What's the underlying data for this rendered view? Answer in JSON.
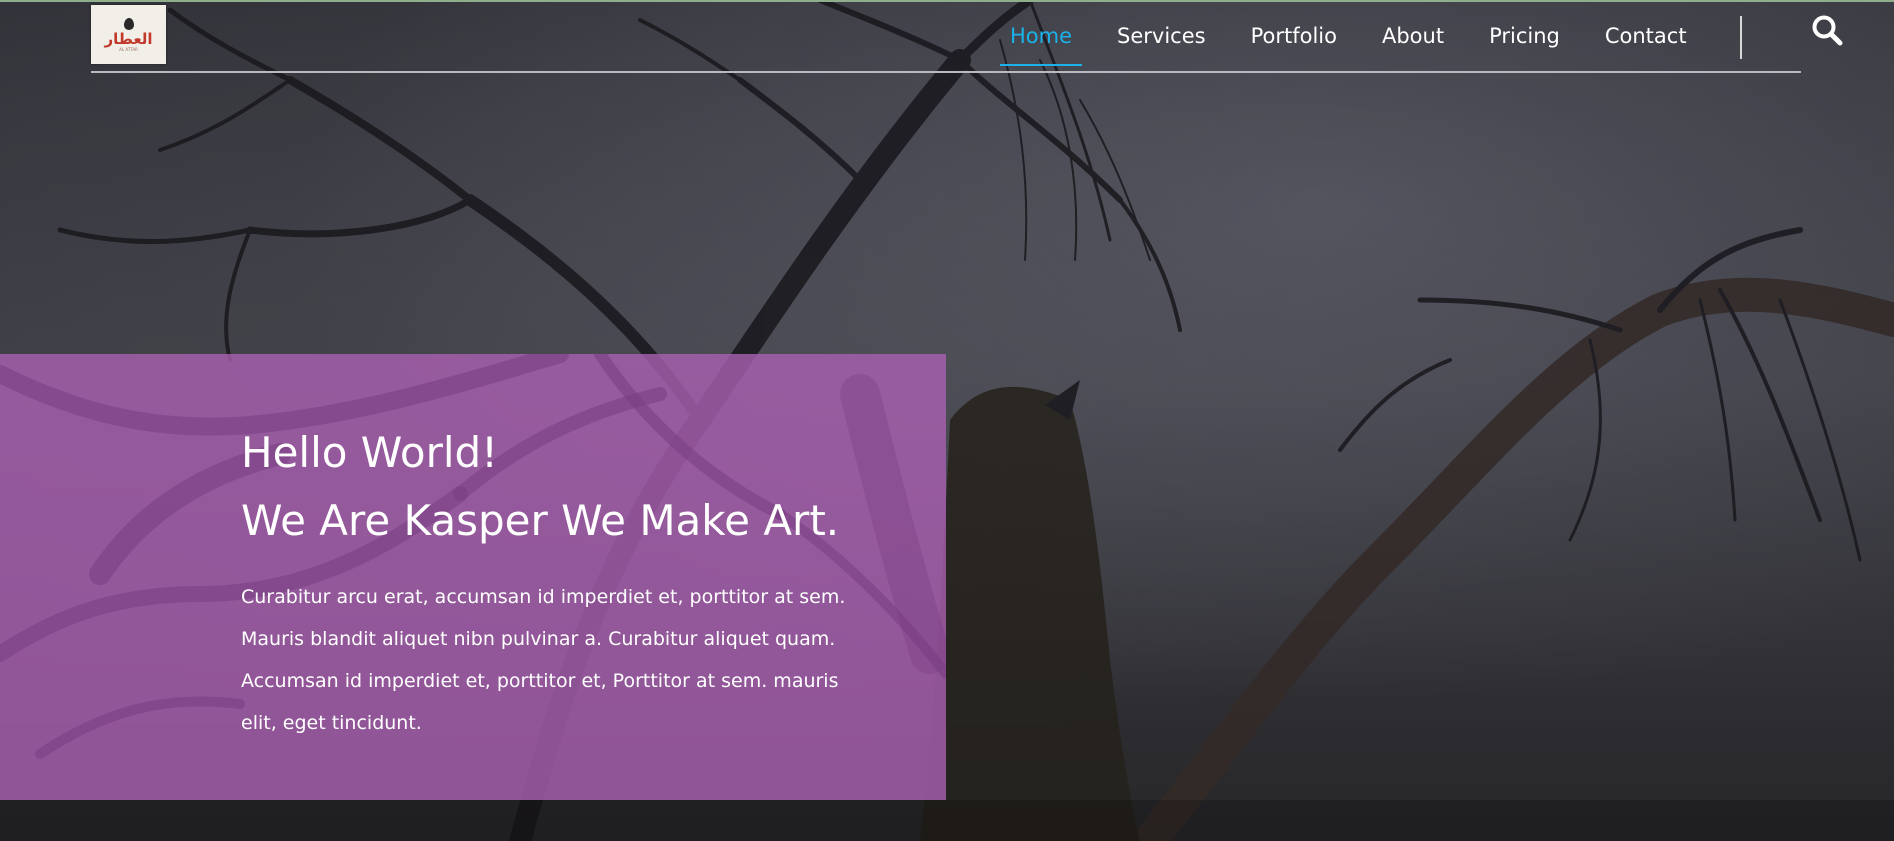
{
  "header": {
    "logo": {
      "text": "العطار",
      "subtext": "AL ATTAR"
    },
    "nav": [
      {
        "label": "Home",
        "active": true
      },
      {
        "label": "Services",
        "active": false
      },
      {
        "label": "Portfolio",
        "active": false
      },
      {
        "label": "About",
        "active": false
      },
      {
        "label": "Pricing",
        "active": false
      },
      {
        "label": "Contact",
        "active": false
      }
    ],
    "search_icon": "search-icon"
  },
  "hero": {
    "title_line1": "Hello World!",
    "title_line2": "We Are Kasper We Make Art.",
    "paragraph_lines": [
      "Curabitur arcu erat, accumsan id imperdiet et, porttitor at sem.",
      "Mauris blandit aliquet nibn pulvinar a. Curabitur aliquet quam.",
      "Accumsan id imperdiet et, porttitor et, Porttitor at sem. mauris",
      "elit, eget tincidunt."
    ]
  },
  "colors": {
    "accent": "#1ab2e8",
    "box": "#aa60b2",
    "text": "#ffffff"
  }
}
